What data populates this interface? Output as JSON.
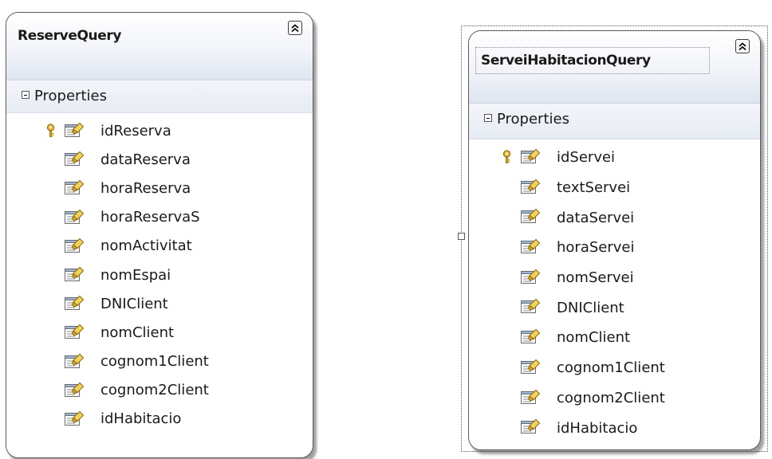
{
  "entities": [
    {
      "title": "ReserveQuery",
      "section": "Properties",
      "properties": [
        {
          "name": "idReserva",
          "key": true
        },
        {
          "name": "dataReserva",
          "key": false
        },
        {
          "name": "horaReserva",
          "key": false
        },
        {
          "name": "horaReservaS",
          "key": false
        },
        {
          "name": "nomActivitat",
          "key": false
        },
        {
          "name": "nomEspai",
          "key": false
        },
        {
          "name": "DNIClient",
          "key": false
        },
        {
          "name": "nomClient",
          "key": false
        },
        {
          "name": "cognom1Client",
          "key": false
        },
        {
          "name": "cognom2Client",
          "key": false
        },
        {
          "name": "idHabitacio",
          "key": false
        }
      ]
    },
    {
      "title": "ServeiHabitacionQuery",
      "section": "Properties",
      "properties": [
        {
          "name": "idServei",
          "key": true
        },
        {
          "name": "textServei",
          "key": false
        },
        {
          "name": "dataServei",
          "key": false
        },
        {
          "name": "horaServei",
          "key": false
        },
        {
          "name": "nomServei",
          "key": false
        },
        {
          "name": "DNIClient",
          "key": false
        },
        {
          "name": "nomClient",
          "key": false
        },
        {
          "name": "cognom1Client",
          "key": false
        },
        {
          "name": "cognom2Client",
          "key": false
        },
        {
          "name": "idHabitacio",
          "key": false
        }
      ]
    }
  ],
  "icons": {
    "collapse": "collapse-chevrons-up-icon",
    "section_toggle": "minus-icon",
    "key": "key-icon",
    "property": "property-icon"
  },
  "colors": {
    "header_gradient_end": "#dfe5f0",
    "section_bg": "#e7ebf3",
    "border": "#5a5a5a",
    "property_icon_yellow": "#f3d25a",
    "key_gold": "#d4a017"
  }
}
